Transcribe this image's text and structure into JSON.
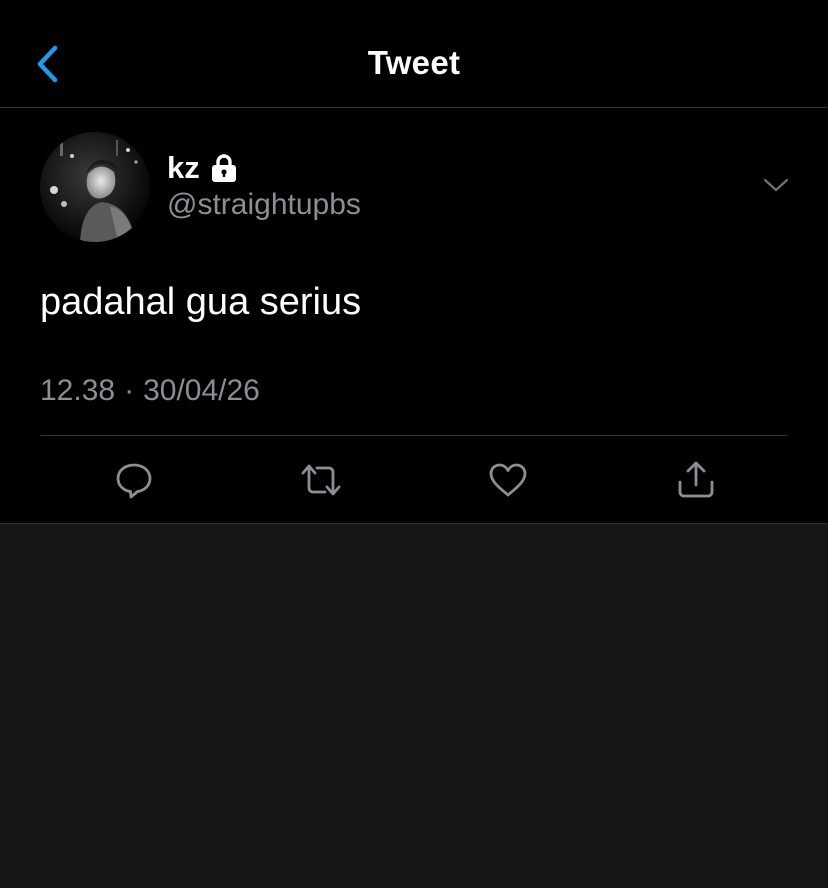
{
  "nav": {
    "title": "Tweet",
    "back_icon": "chevron-left-icon",
    "accent": "#1d9bf0"
  },
  "tweet": {
    "display_name": "kz",
    "protected_icon": "lock-icon",
    "handle": "@straightupbs",
    "text": "padahal gua serius",
    "time": "12.38",
    "separator": "·",
    "date": "30/04/26",
    "more_icon": "chevron-down-icon"
  },
  "actions": [
    {
      "name": "reply",
      "icon": "comment-icon"
    },
    {
      "name": "retweet",
      "icon": "retweet-icon"
    },
    {
      "name": "like",
      "icon": "heart-icon"
    },
    {
      "name": "share",
      "icon": "share-icon"
    }
  ],
  "colors": {
    "background": "#000000",
    "empty_area": "#161618",
    "secondary_text": "#8b8f94",
    "divider": "#2f3336"
  }
}
